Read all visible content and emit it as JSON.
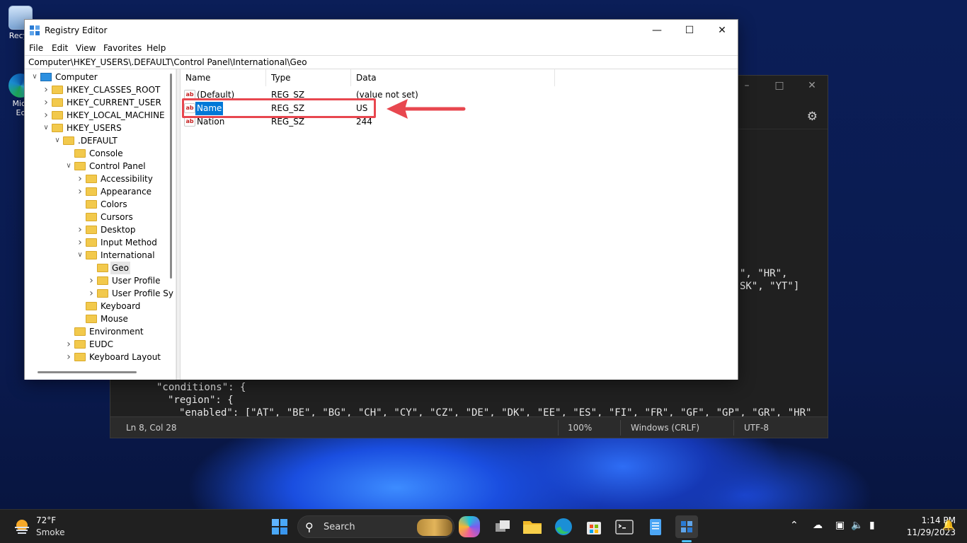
{
  "desktop": {
    "icons": [
      {
        "label": "Recyc",
        "icon": "recycle-bin-icon"
      },
      {
        "label": "Micr",
        "label2": "Ec",
        "icon": "edge-icon"
      }
    ]
  },
  "notepad": {
    "code": {
      "line_hr": "\", \"HR\",",
      "line_yt": "SK\", \"YT\"]",
      "conditions": "\"conditions\": {",
      "region": "\"region\": {",
      "enabled": "\"enabled\": [\"AT\", \"BE\", \"BG\", \"CH\", \"CY\", \"CZ\", \"DE\", \"DK\", \"EE\", \"ES\", \"FI\", \"FR\", \"GF\", \"GP\", \"GR\", \"HR\""
    },
    "status": {
      "position": "Ln 8, Col 28",
      "zoom": "100%",
      "line_ending": "Windows (CRLF)",
      "encoding": "UTF-8"
    },
    "icons": {
      "settings": "gear-icon"
    }
  },
  "regedit": {
    "title": "Registry Editor",
    "menu": [
      "File",
      "Edit",
      "View",
      "Favorites",
      "Help"
    ],
    "address": "Computer\\HKEY_USERS\\.DEFAULT\\Control Panel\\International\\Geo",
    "tree": [
      {
        "label": "Computer",
        "depth": 0,
        "expander": "v",
        "icon": "computer"
      },
      {
        "label": "HKEY_CLASSES_ROOT",
        "depth": 1,
        "expander": ">",
        "icon": "folder"
      },
      {
        "label": "HKEY_CURRENT_USER",
        "depth": 1,
        "expander": ">",
        "icon": "folder"
      },
      {
        "label": "HKEY_LOCAL_MACHINE",
        "depth": 1,
        "expander": ">",
        "icon": "folder"
      },
      {
        "label": "HKEY_USERS",
        "depth": 1,
        "expander": "v",
        "icon": "folder"
      },
      {
        "label": ".DEFAULT",
        "depth": 2,
        "expander": "v",
        "icon": "folder"
      },
      {
        "label": "Console",
        "depth": 3,
        "expander": "",
        "icon": "folder"
      },
      {
        "label": "Control Panel",
        "depth": 3,
        "expander": "v",
        "icon": "folder"
      },
      {
        "label": "Accessibility",
        "depth": 4,
        "expander": ">",
        "icon": "folder"
      },
      {
        "label": "Appearance",
        "depth": 4,
        "expander": ">",
        "icon": "folder"
      },
      {
        "label": "Colors",
        "depth": 4,
        "expander": "",
        "icon": "folder"
      },
      {
        "label": "Cursors",
        "depth": 4,
        "expander": "",
        "icon": "folder"
      },
      {
        "label": "Desktop",
        "depth": 4,
        "expander": ">",
        "icon": "folder"
      },
      {
        "label": "Input Method",
        "depth": 4,
        "expander": ">",
        "icon": "folder"
      },
      {
        "label": "International",
        "depth": 4,
        "expander": "v",
        "icon": "folder"
      },
      {
        "label": "Geo",
        "depth": 5,
        "expander": "",
        "icon": "folder-open",
        "selected": true
      },
      {
        "label": "User Profile",
        "depth": 5,
        "expander": ">",
        "icon": "folder"
      },
      {
        "label": "User Profile Sy",
        "depth": 5,
        "expander": ">",
        "icon": "folder"
      },
      {
        "label": "Keyboard",
        "depth": 4,
        "expander": "",
        "icon": "folder"
      },
      {
        "label": "Mouse",
        "depth": 4,
        "expander": "",
        "icon": "folder"
      },
      {
        "label": "Environment",
        "depth": 3,
        "expander": "",
        "icon": "folder"
      },
      {
        "label": "EUDC",
        "depth": 3,
        "expander": ">",
        "icon": "folder"
      },
      {
        "label": "Keyboard Layout",
        "depth": 3,
        "expander": ">",
        "icon": "folder"
      }
    ],
    "columns": [
      "Name",
      "Type",
      "Data"
    ],
    "values": [
      {
        "name": "(Default)",
        "type": "REG_SZ",
        "data": "(value not set)"
      },
      {
        "name": "Name",
        "type": "REG_SZ",
        "data": "US",
        "selected": true
      },
      {
        "name": "Nation",
        "type": "REG_SZ",
        "data": "244"
      }
    ],
    "annotation": {
      "highlight_color": "#e8474f"
    },
    "colors": {
      "selection": "#0078d7",
      "folder": "#f2c94c"
    }
  },
  "taskbar": {
    "weather": {
      "temp": "72°F",
      "desc": "Smoke"
    },
    "search_label": "Search",
    "apps": [
      "windows-start-icon",
      "search-icon",
      "copilot-icon",
      "task-view-icon",
      "file-explorer-icon",
      "edge-icon",
      "store-icon",
      "terminal-icon",
      "notepad-icon",
      "regedit-icon"
    ],
    "tray": [
      "chevron-up-icon",
      "onedrive-icon",
      "network-icon",
      "volume-icon",
      "battery-icon",
      "notification-icon"
    ],
    "clock": {
      "time": "1:14 PM",
      "date": "11/29/2023"
    }
  }
}
